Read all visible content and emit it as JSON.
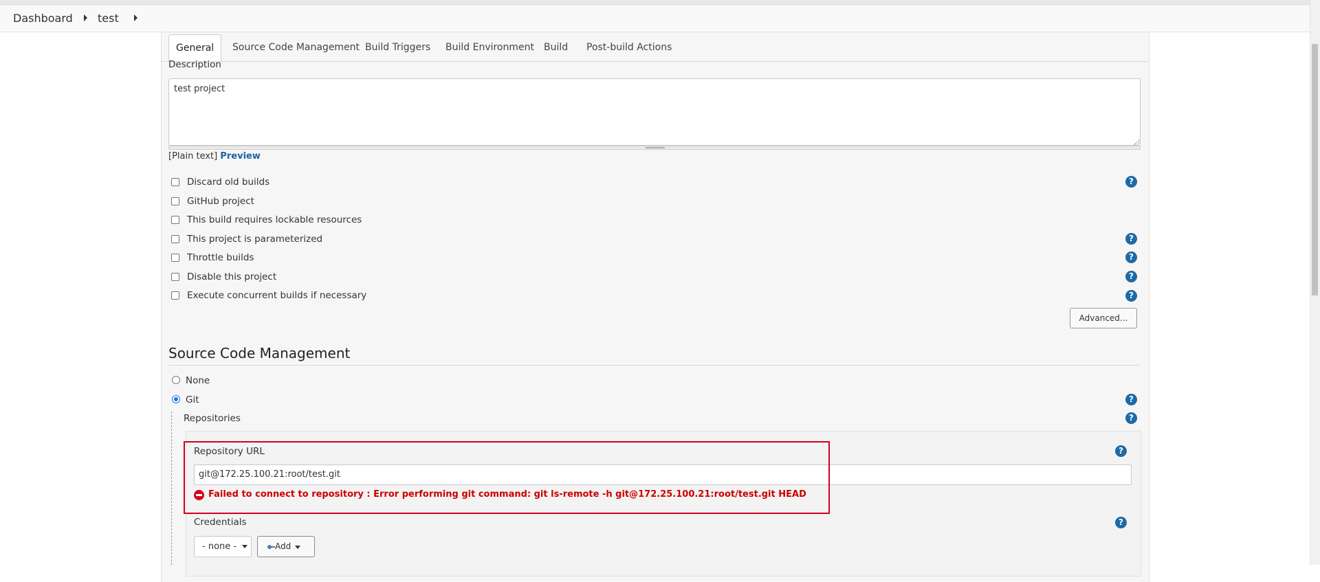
{
  "breadcrumb": {
    "items": [
      "Dashboard",
      "test"
    ]
  },
  "tabs": [
    {
      "label": "General"
    },
    {
      "label": "Source Code Management"
    },
    {
      "label": "Build Triggers"
    },
    {
      "label": "Build Environment"
    },
    {
      "label": "Build"
    },
    {
      "label": "Post-build Actions"
    }
  ],
  "general": {
    "description_label": "Description",
    "description_value": "test  project",
    "plain_text": "[Plain text]",
    "preview_label": "Preview",
    "options": [
      {
        "label": "Discard old builds",
        "checked": false,
        "help": true
      },
      {
        "label": "GitHub project",
        "checked": false,
        "help": false
      },
      {
        "label": "This build requires lockable resources",
        "checked": false,
        "help": false
      },
      {
        "label": "This project is parameterized",
        "checked": false,
        "help": true
      },
      {
        "label": "Throttle builds",
        "checked": false,
        "help": true
      },
      {
        "label": "Disable this project",
        "checked": false,
        "help": true
      },
      {
        "label": "Execute concurrent builds if necessary",
        "checked": false,
        "help": true
      }
    ],
    "advanced_label": "Advanced..."
  },
  "scm": {
    "title": "Source Code Management",
    "none_label": "None",
    "git_label": "Git",
    "repositories_label": "Repositories",
    "repo_url_label": "Repository URL",
    "repo_url_value": "git@172.25.100.21:root/test.git",
    "error_message": "Failed to connect to repository : Error performing git command: git ls-remote -h git@172.25.100.21:root/test.git HEAD",
    "credentials_label": "Credentials",
    "credentials_selected": "- none -",
    "add_label": "Add"
  },
  "help_glyph": "?",
  "colors": {
    "accent": "#1e6aa6",
    "error": "#cc0000",
    "highlight_border": "#d4001a"
  }
}
